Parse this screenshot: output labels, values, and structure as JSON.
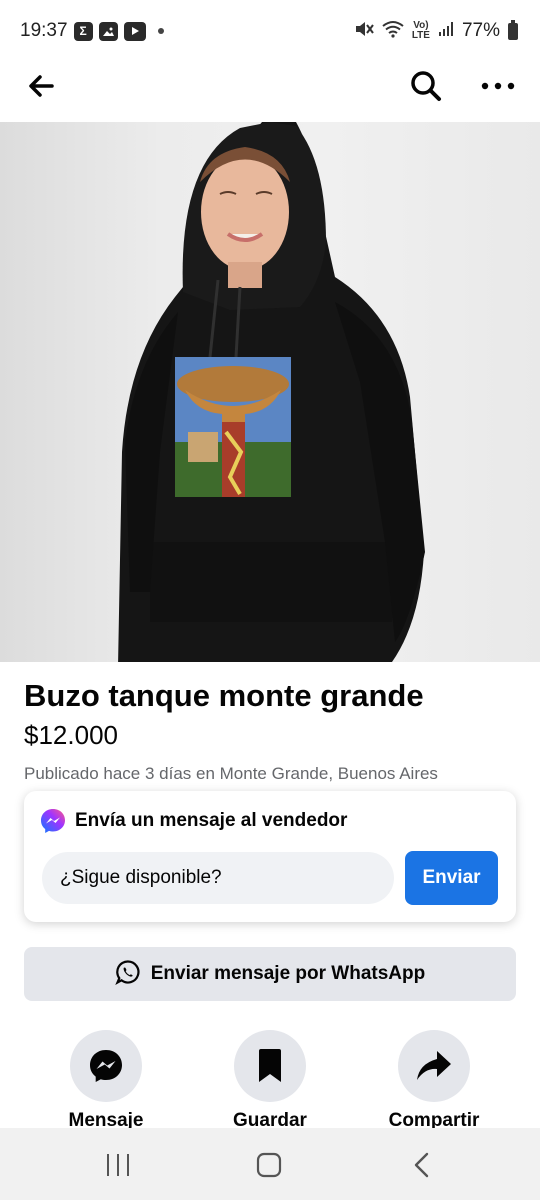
{
  "status_bar": {
    "time": "19:37",
    "battery": "77%",
    "left_icons": [
      "sigma-icon",
      "gallery-icon",
      "youtube-icon",
      "dot-icon"
    ],
    "right_icons": [
      "mute-icon",
      "wifi-icon",
      "volte-icon",
      "signal-icon",
      "battery-icon"
    ],
    "volte_text": "Vo)\nLTE"
  },
  "top_nav": {
    "icons": [
      "back-arrow-icon",
      "search-icon",
      "more-icon"
    ]
  },
  "product": {
    "title": "Buzo tanque monte grande",
    "price": "$12.000",
    "published": "Publicado hace 3 días en Monte Grande, Buenos Aires"
  },
  "message_card": {
    "title": "Envía un mensaje al vendedor",
    "input_value": "¿Sigue disponible?",
    "send_label": "Enviar",
    "icon": "messenger-icon"
  },
  "whatsapp": {
    "label": "Enviar mensaje por WhatsApp",
    "icon": "whatsapp-icon"
  },
  "actions": [
    {
      "label": "Mensaje",
      "icon": "messenger-icon"
    },
    {
      "label": "Guardar",
      "icon": "bookmark-icon"
    },
    {
      "label": "Compartir",
      "icon": "share-icon"
    }
  ],
  "colors": {
    "accent": "#1b74e4",
    "secondary_button": "#e4e6eb",
    "input_bg": "#f0f2f5",
    "muted_text": "#65676b"
  }
}
